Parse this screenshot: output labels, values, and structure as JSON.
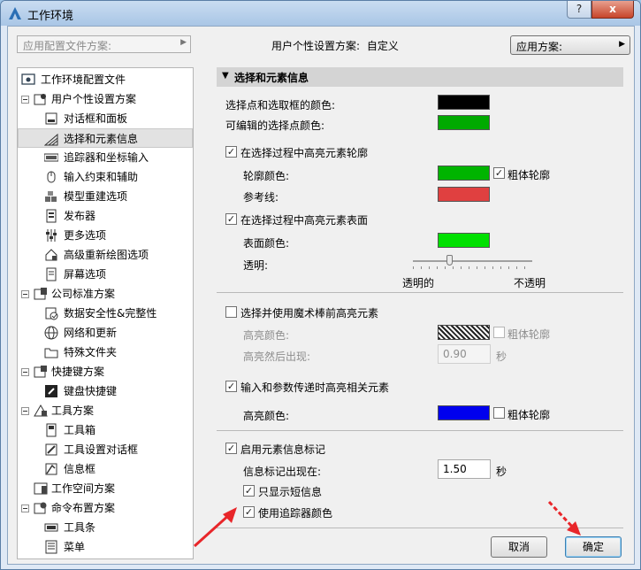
{
  "window": {
    "title": "工作环境",
    "help_label": "?",
    "close_label": "x"
  },
  "topbar": {
    "profile_placeholder": "应用配置文件方案:",
    "user_scheme_label": "用户个性设置方案:",
    "user_scheme_value": "自定义",
    "apply_label": "应用方案:"
  },
  "tree": {
    "items": [
      {
        "label": "工作环境配置文件",
        "icon": "profile-icon"
      },
      {
        "label": "用户个性设置方案",
        "icon": "user-settings-icon"
      },
      {
        "label": "对话框和面板",
        "icon": "dialog-icon"
      },
      {
        "label": "选择和元素信息",
        "icon": "selection-icon"
      },
      {
        "label": "追踪器和坐标输入",
        "icon": "tracker-icon"
      },
      {
        "label": "输入约束和辅助",
        "icon": "mouse-icon"
      },
      {
        "label": "模型重建选项",
        "icon": "model-icon"
      },
      {
        "label": "发布器",
        "icon": "publisher-icon"
      },
      {
        "label": "更多选项",
        "icon": "options-icon"
      },
      {
        "label": "高级重新绘图选项",
        "icon": "redraw-icon"
      },
      {
        "label": "屏幕选项",
        "icon": "screen-icon"
      },
      {
        "label": "公司标准方案",
        "icon": "company-icon"
      },
      {
        "label": "数据安全性&完整性",
        "icon": "data-security-icon"
      },
      {
        "label": "网络和更新",
        "icon": "globe-icon"
      },
      {
        "label": "特殊文件夹",
        "icon": "folder-icon"
      },
      {
        "label": "快捷键方案",
        "icon": "shortcut-scheme-icon"
      },
      {
        "label": "键盘快捷键",
        "icon": "keyboard-icon"
      },
      {
        "label": "工具方案",
        "icon": "tool-scheme-icon"
      },
      {
        "label": "工具箱",
        "icon": "toolbox-icon"
      },
      {
        "label": "工具设置对话框",
        "icon": "tool-settings-icon"
      },
      {
        "label": "信息框",
        "icon": "infobox-icon"
      },
      {
        "label": "工作空间方案",
        "icon": "workspace-icon"
      },
      {
        "label": "命令布置方案",
        "icon": "command-scheme-icon"
      },
      {
        "label": "工具条",
        "icon": "toolbar-icon"
      },
      {
        "label": "菜单",
        "icon": "menu-icon"
      }
    ]
  },
  "panel": {
    "header": "选择和元素信息",
    "sel_point_color_label": "选择点和选取框的颜色:",
    "editable_point_color_label": "可编辑的选择点颜色:",
    "highlight_contour_label": "在选择过程中高亮元素轮廓",
    "contour_color_label": "轮廓颜色:",
    "bold_contour_label": "粗体轮廓",
    "ref_line_label": "参考线:",
    "highlight_surface_label": "在选择过程中高亮元素表面",
    "surface_color_label": "表面颜色:",
    "transparency_label": "透明:",
    "transparency_value": 0.3,
    "transparent_label": "透明的",
    "opaque_label": "不透明",
    "magic_wand_label": "选择并使用魔术棒前高亮元素",
    "highlight_color_label": "高亮颜色:",
    "bold_contour_label_2": "粗体轮廓",
    "highlight_delay_label": "高亮然后出现:",
    "highlight_delay_value": "0.90",
    "seconds_label": "秒",
    "input_highlight_label": "输入和参数传递时高亮相关元素",
    "highlight_color_label_2": "高亮颜色:",
    "bold_contour_label_3": "粗体轮廓",
    "enable_info_tag_label": "启用元素信息标记",
    "info_tag_appear_label": "信息标记出现在:",
    "info_tag_delay_value": "1.50",
    "seconds_label_2": "秒",
    "short_info_label": "只显示短信息",
    "tracker_color_label": "使用追踪器颜色"
  },
  "colors": {
    "sel_point": "#000000",
    "editable_point": "#00aa00",
    "contour": "#00b400",
    "ref_line": "#e04040",
    "surface": "#00e000",
    "input_highlight": "#0000ee",
    "annotation_arrow": "#e8262a"
  },
  "buttons": {
    "cancel": "取消",
    "ok": "确定"
  }
}
